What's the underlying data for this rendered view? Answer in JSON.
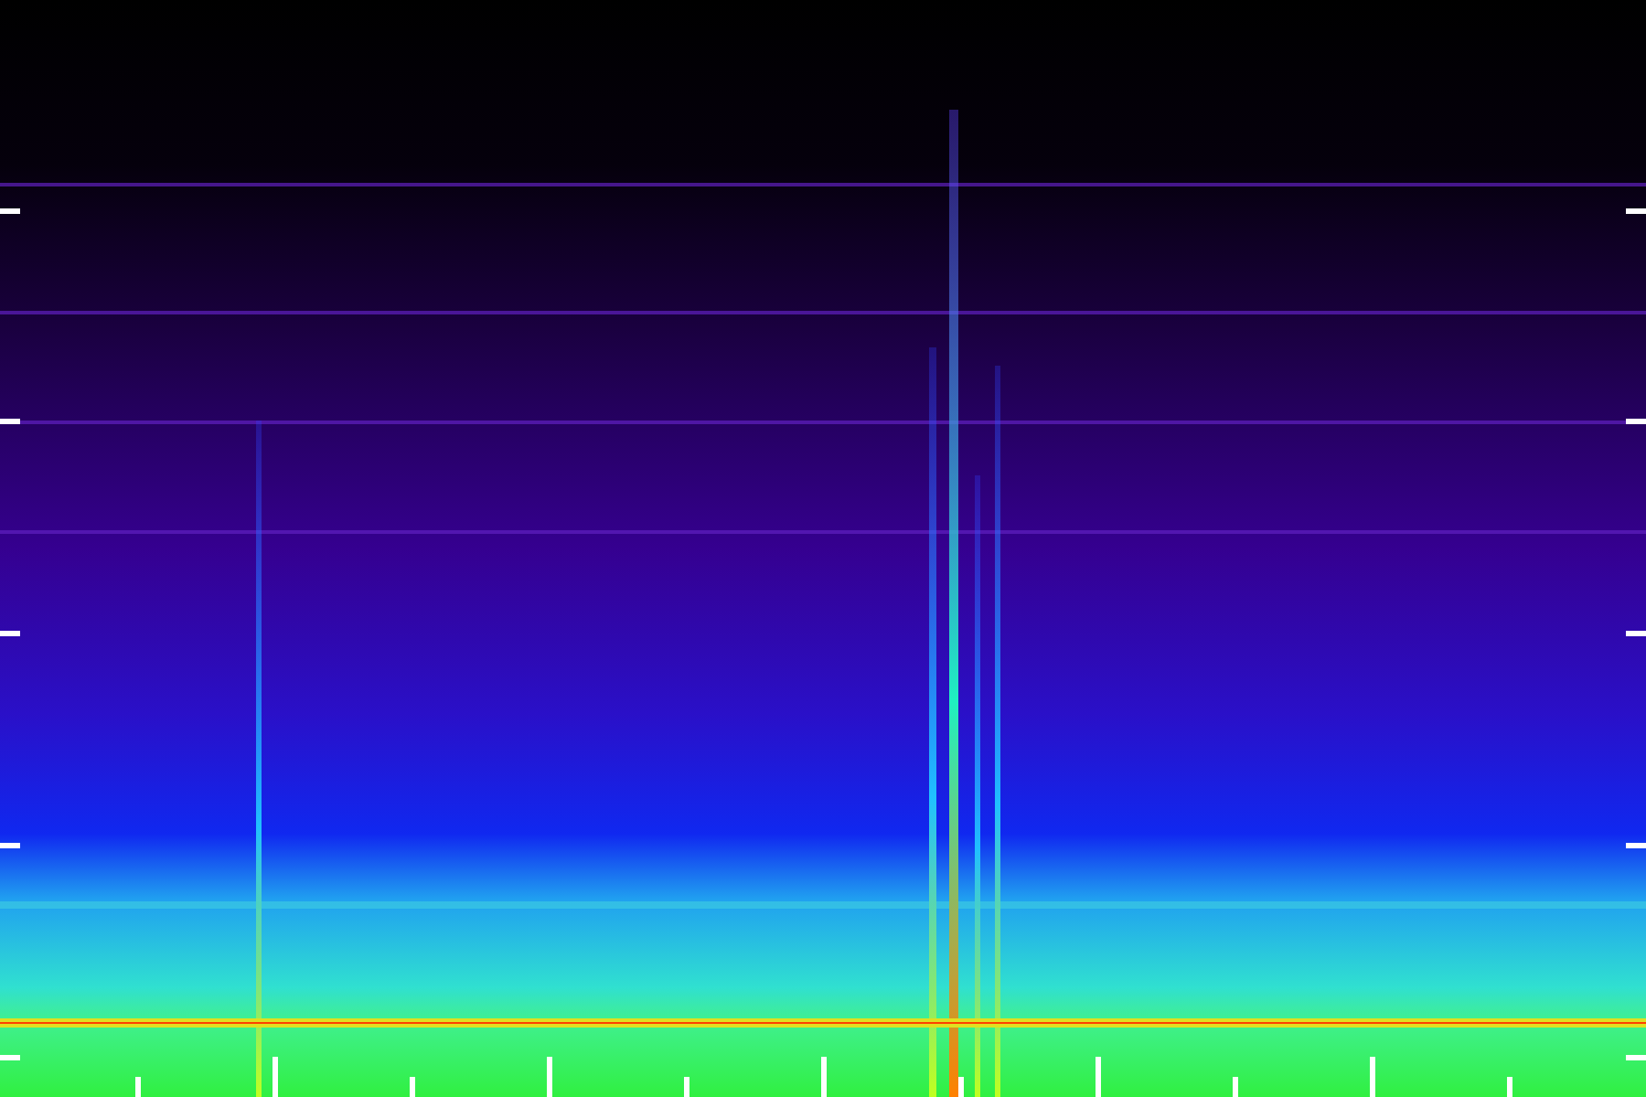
{
  "view": {
    "kind": "spectrogram"
  }
}
